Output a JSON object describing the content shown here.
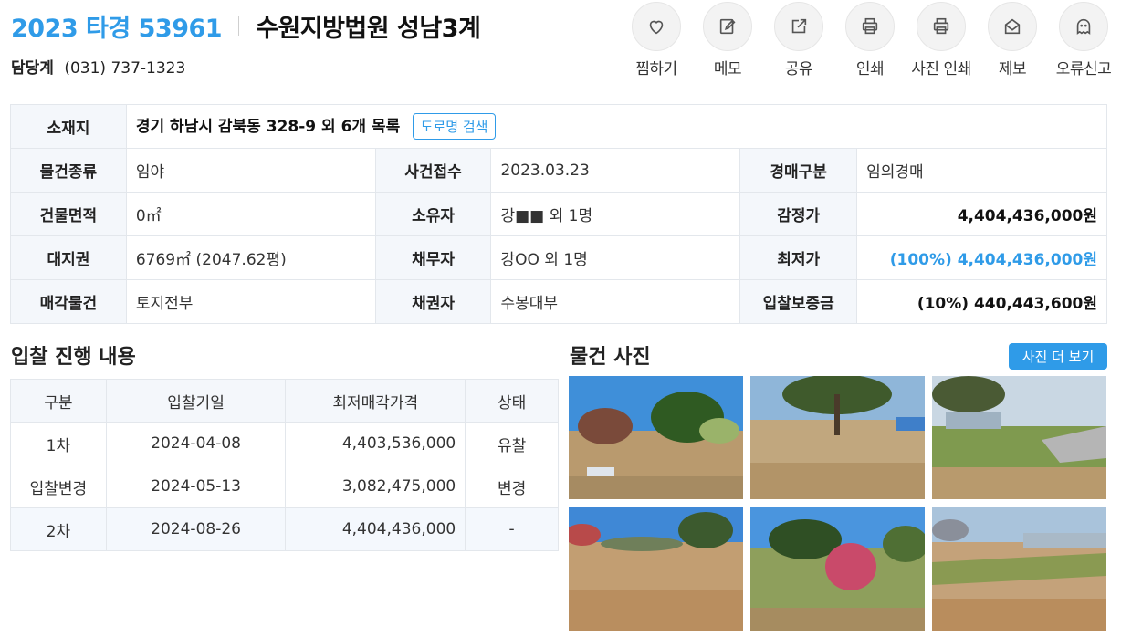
{
  "header": {
    "case_no": "2023 타경 53961",
    "court": "수원지방법원 성남3계",
    "contact_label": "담당계",
    "contact_phone": "(031) 737-1323"
  },
  "actions": [
    {
      "label": "찜하기",
      "icon": "heart-icon"
    },
    {
      "label": "메모",
      "icon": "memo-edit-icon"
    },
    {
      "label": "공유",
      "icon": "share-icon"
    },
    {
      "label": "인쇄",
      "icon": "printer-icon"
    },
    {
      "label": "사진 인쇄",
      "icon": "printer-icon"
    },
    {
      "label": "제보",
      "icon": "envelope-icon"
    },
    {
      "label": "오류신고",
      "icon": "ghost-icon"
    }
  ],
  "info": {
    "location_label": "소재지",
    "location_value": "경기 하남시 감북동 328-9 외 6개 목록",
    "road_search_label": "도로명 검색",
    "rows": [
      {
        "l1": "물건종류",
        "v1": "임야",
        "l2": "사건접수",
        "v2": "2023.03.23",
        "l3": "경매구분",
        "v3": "임의경매"
      },
      {
        "l1": "건물면적",
        "v1": "0㎡",
        "l2": "소유자",
        "v2": "강■■ 외 1명",
        "l3": "감정가",
        "v3": "4,404,436,000원"
      },
      {
        "l1": "대지권",
        "v1": "6769㎡ (2047.62평)",
        "l2": "채무자",
        "v2": "강OO 외 1명",
        "l3": "최저가",
        "v3": "(100%) 4,404,436,000원"
      },
      {
        "l1": "매각물건",
        "v1": "토지전부",
        "l2": "채권자",
        "v2": "수봉대부",
        "l3": "입찰보증금",
        "v3": "(10%) 440,443,600원"
      }
    ]
  },
  "bid_section": {
    "title": "입찰 진행 내용",
    "headers": [
      "구분",
      "입찰기일",
      "최저매각가격",
      "상태"
    ],
    "rows": [
      {
        "round": "1차",
        "date": "2024-04-08",
        "price": "4,403,536,000",
        "status": "유찰"
      },
      {
        "round": "입찰변경",
        "date": "2024-05-13",
        "price": "3,082,475,000",
        "status": "변경"
      },
      {
        "round": "2차",
        "date": "2024-08-26",
        "price": "4,404,436,000",
        "status": "-"
      }
    ]
  },
  "photo_section": {
    "title": "물건 사진",
    "more_label": "사진 더 보기",
    "photo_count": 6
  },
  "colors": {
    "accent": "#2f9be8",
    "header_cell": "#f4f7fb",
    "border": "#e3e7ec"
  }
}
